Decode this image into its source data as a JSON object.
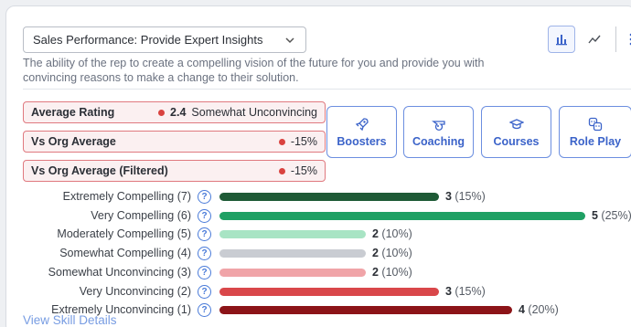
{
  "metric_select": {
    "value": "Sales Performance: Provide Expert Insights"
  },
  "description": "The ability of the rep to create a compelling vision of the future for you and provide you with convincing reasons to make a change to their solution.",
  "toolbar": {
    "icons": [
      "bar-chart-icon",
      "line-chart-icon",
      "more-vertical-icon"
    ]
  },
  "stats": [
    {
      "label": "Average Rating",
      "score": "2.4",
      "text": "Somewhat Unconvincing"
    },
    {
      "label": "Vs Org Average",
      "text": "-15%"
    },
    {
      "label": "Vs Org Average (Filtered)",
      "text": "-15%"
    }
  ],
  "actions": [
    {
      "label": "Boosters",
      "icon": "rocket-icon"
    },
    {
      "label": "Coaching",
      "icon": "whistle-icon"
    },
    {
      "label": "Courses",
      "icon": "graduation-cap-icon"
    },
    {
      "label": "Role Play",
      "icon": "masks-icon"
    }
  ],
  "chart_data": {
    "type": "bar",
    "orientation": "horizontal",
    "categories": [
      "Extremely Compelling (7)",
      "Very Compelling (6)",
      "Moderately Compelling (5)",
      "Somewhat Compelling (4)",
      "Somewhat Unconvincing (3)",
      "Very Unconvincing (2)",
      "Extremely Unconvincing (1)"
    ],
    "values": [
      3,
      5,
      2,
      2,
      2,
      3,
      4
    ],
    "percent_labels": [
      "(15%)",
      "(25%)",
      "(10%)",
      "(10%)",
      "(10%)",
      "(15%)",
      "(20%)"
    ],
    "colors": [
      "#1e5a36",
      "#1fa064",
      "#a8e4c4",
      "#c9ccd2",
      "#f0a4a8",
      "#d9474a",
      "#8c1418"
    ]
  },
  "footer_link": "View Skill Details",
  "colors": {
    "accent": "#4a7bd9",
    "negative": "#d9423f"
  }
}
